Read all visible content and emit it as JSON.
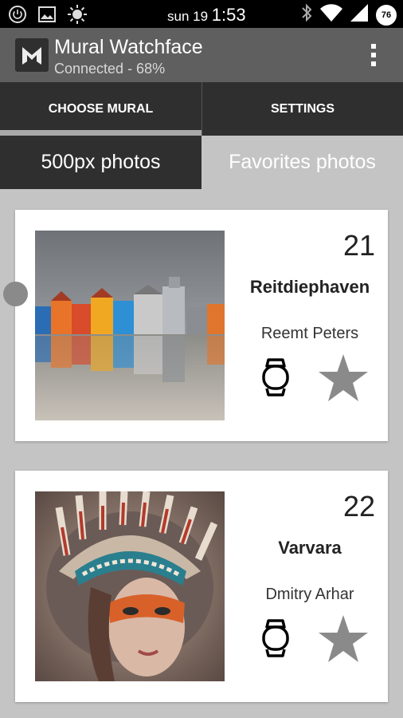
{
  "status_bar": {
    "day": "sun 19",
    "time": "1:53",
    "battery": "76"
  },
  "app_bar": {
    "title": "Mural Watchface",
    "subtitle": "Connected - 68%"
  },
  "tabs": [
    {
      "label": "CHOOSE MURAL",
      "active": true
    },
    {
      "label": "SETTINGS",
      "active": false
    }
  ],
  "subtabs": [
    {
      "label": "500px photos",
      "active": true
    },
    {
      "label": "Favorites photos",
      "active": false
    }
  ],
  "cards": [
    {
      "number": "21",
      "title": "Reitdiephaven",
      "author": "Reemt Peters"
    },
    {
      "number": "22",
      "title": "Varvara",
      "author": "Dmitry Arhar"
    }
  ],
  "colors": {
    "appbar": "#5f5f5f",
    "tabbar": "#2f2f2f",
    "star": "#8a8a8a"
  }
}
